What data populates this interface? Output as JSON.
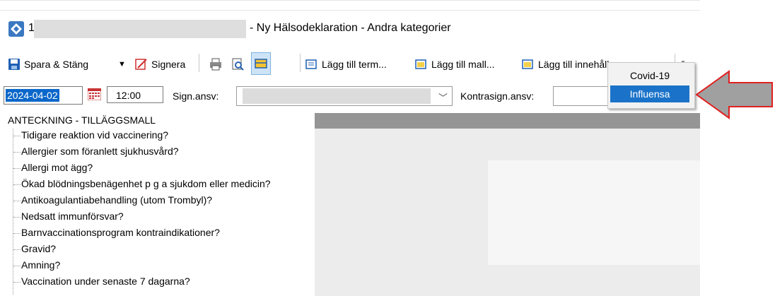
{
  "window": {
    "title_prefix": "1",
    "title": "- Ny Hälsodeklaration - Andra kategorier"
  },
  "toolbar": {
    "save_close": "Spara & Stäng",
    "sign": "Signera",
    "add_term": "Lägg till term...",
    "add_template": "Lägg till mall...",
    "add_content": "Lägg till innehåll..."
  },
  "fields": {
    "date": "2024-04-02",
    "time": "12:00",
    "sign_label": "Sign.ansv:",
    "kontra_label": "Kontrasign.ansv:"
  },
  "menu": {
    "items": [
      "Covid-19",
      "Influensa"
    ],
    "selected": "Influensa"
  },
  "tree": {
    "root": "ANTECKNING - TILLÄGGSMALL",
    "items": [
      "Tidigare reaktion vid vaccinering?",
      "Allergier som föranlett sjukhusvård?",
      "Allergi mot ägg?",
      "Ökad blödningsbenägenhet p g a sjukdom eller medicin?",
      "Antikoagulantiabehandling (utom Trombyl)?",
      "Nedsatt immunförsvar?",
      "Barnvaccinationsprogram kontraindikationer?",
      "Gravid?",
      "Amning?",
      "Vaccination under senaste 7 dagarna?"
    ]
  },
  "colors": {
    "accent": "#1b73c9",
    "panel_header": "#959595",
    "callout_arrow": "#a0a0a0",
    "callout_border": "#e02020"
  }
}
